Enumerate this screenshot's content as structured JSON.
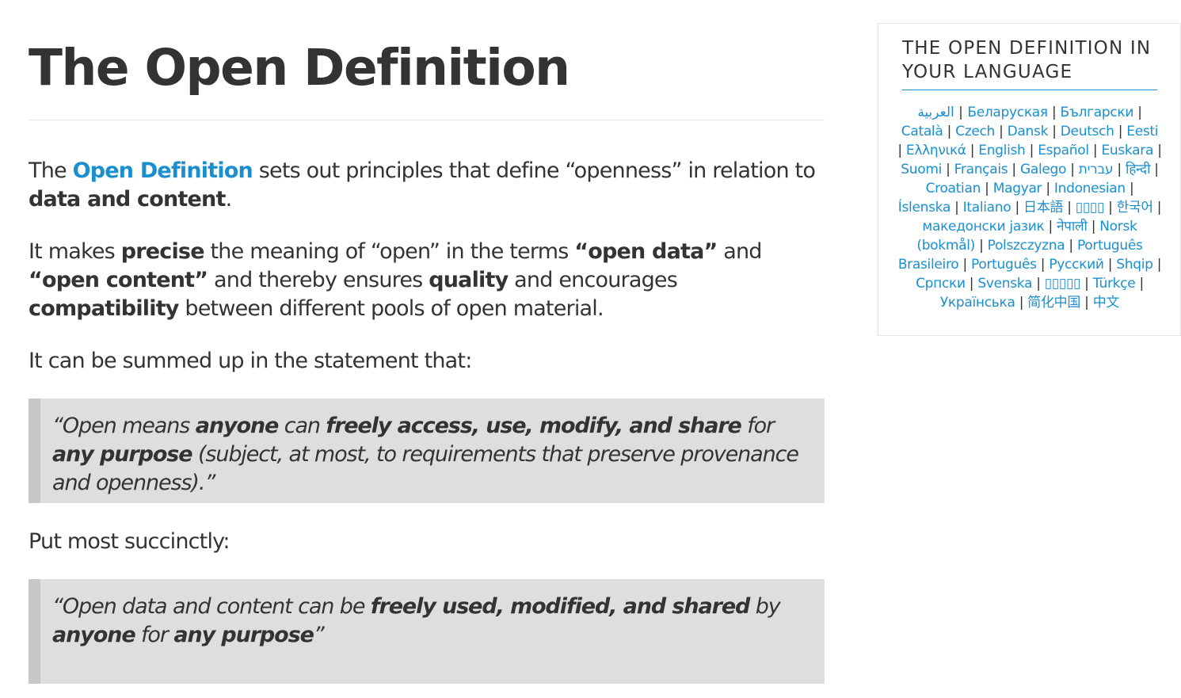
{
  "main": {
    "title": "The Open Definition",
    "p1": {
      "pre": "The ",
      "link": "Open Definition",
      "mid": " sets out principles that define “openness” in relation to ",
      "bold": "data and content",
      "post": "."
    },
    "p2": {
      "t1": "It makes ",
      "b1": "precise",
      "t2": " the meaning of “open” in the terms ",
      "b2": "“open data”",
      "t3": " and ",
      "b3": "“open content”",
      "t4": " and thereby ensures ",
      "b4": "quality",
      "t5": " and encourages ",
      "b5": "compatibility",
      "t6": " between different pools of open material."
    },
    "p3": "It can be summed up in the statement that:",
    "quote1": {
      "t1": "“Open means ",
      "b1": "anyone",
      "t2": " can ",
      "b2": "freely access, use, modify, and share",
      "t3": " for ",
      "b3": "any purpose",
      "t4": " (subject, at most, to requirements that preserve provenance and openness).”"
    },
    "p4": "Put most succinctly:",
    "quote2": {
      "t1": "“Open data and content can be ",
      "b1": "freely used, modified, and shared",
      "t2": " by ",
      "b2": "anyone",
      "t3": " for ",
      "b3": "any purpose",
      "t4": "”"
    }
  },
  "sidebar": {
    "title": "The Open Definition in your language",
    "languages": [
      "العربية",
      "Беларуская",
      "Български",
      "Català",
      "Czech",
      "Dansk",
      "Deutsch",
      "Eesti",
      "Ελληνικά",
      "English",
      "Español",
      "Euskara",
      "Suomi",
      "Français",
      "Galego",
      "עברית",
      "हिन्दी",
      "Croatian",
      "Magyar",
      "Indonesian",
      "Íslenska",
      "Italiano",
      "日本語",
      "▯▯▯▯",
      "한국어",
      "македонски јазик",
      "नेपाली",
      "Norsk (bokmål)",
      "Polszczyzna",
      "Português Brasileiro",
      "Português",
      "Русский",
      "Shqip",
      "Српски",
      "Svenska",
      "▯▯▯▯▯",
      "Türkçe",
      "Українська",
      "简化中国",
      "中文"
    ],
    "separator": "|"
  },
  "colors": {
    "link": "#1a8fd0",
    "text": "#333333",
    "quote_bg": "#dedede",
    "quote_border": "#c7c7c7"
  }
}
